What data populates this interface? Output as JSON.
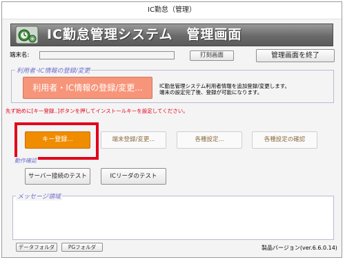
{
  "window": {
    "title": "IC勤怠（管理）"
  },
  "banner": {
    "title": "IC勤怠管理システム　管理画面",
    "logo_icon": "clock-gear-icon"
  },
  "toolbar": {
    "terminal_label": "端末名:",
    "terminal_value": "",
    "print_label": "打刻画面",
    "exit_label": "管理画面を終了"
  },
  "user_section": {
    "title": "利用者･IC情報の登録/変更",
    "button_label": "利用者・IC情報の登録/変更...",
    "description_line1": "IC勤怠管理システム利用者情報を追加登録/変更します。",
    "description_line2": "端末の設定完了後、登録が可能になります。"
  },
  "notice": {
    "text": "先ず始めに[キー登録..]ボタンを押してインストールキーを設定してください。",
    "color": "#e2001a"
  },
  "settings": {
    "key_register_label": "キー登録...",
    "terminal_register_label": "端末登録/変更...",
    "various_settings_label": "各種設定...",
    "confirm_settings_label": "各種設定の確認"
  },
  "operation_check": {
    "title": "動作確認",
    "server_test_label": "サーバー接続のテスト",
    "reader_test_label": "ICリーダのテスト"
  },
  "message_area": {
    "title": "メッセージ領域",
    "content": ""
  },
  "footer": {
    "data_folder_label": "データフォルダ",
    "pg_folder_label": "PGフォルダ",
    "version": "製品バージョン(ver.6.6.0.14)"
  },
  "colors": {
    "accent_orange": "#f08c00",
    "salmon": "#f7957a",
    "highlight_red": "#e2001a"
  }
}
